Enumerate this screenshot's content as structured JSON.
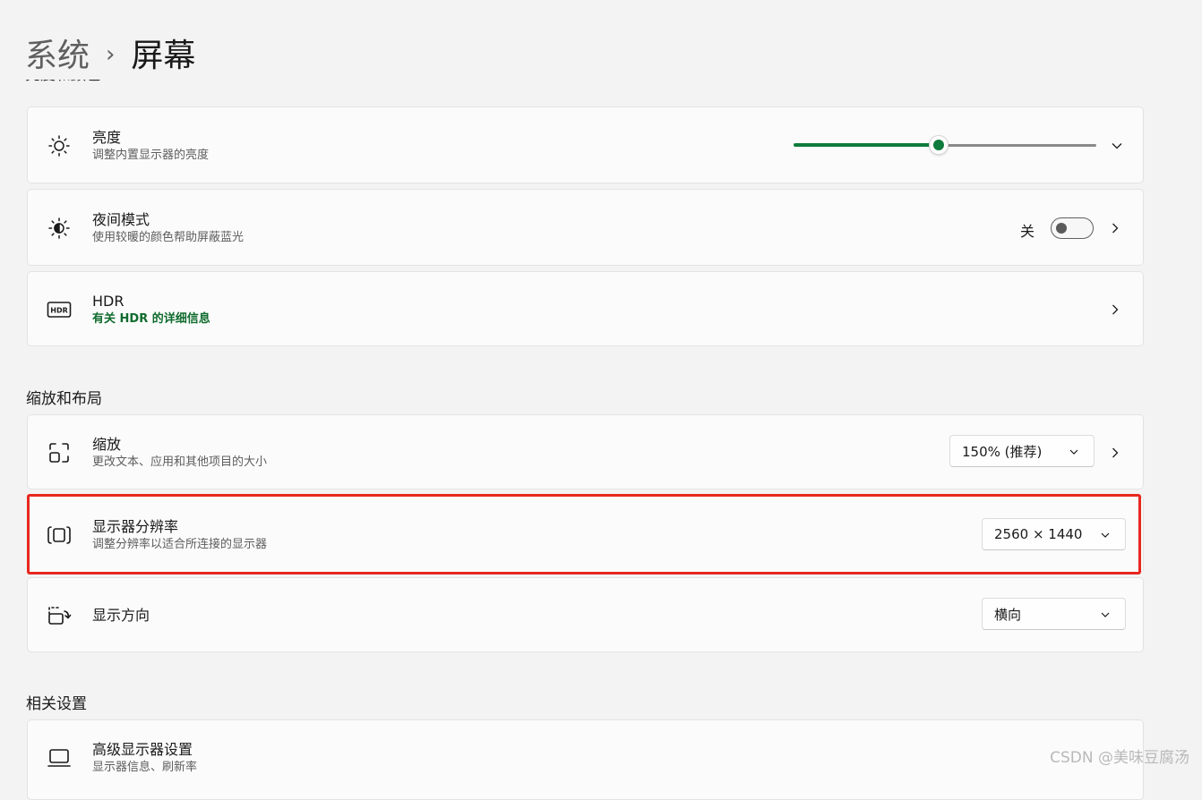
{
  "breadcrumb": {
    "parent": "系统",
    "separator": "›",
    "current": "屏幕"
  },
  "sections": {
    "brightness_color": "亮度和颜色",
    "scale_layout": "缩放和布局",
    "related": "相关设置"
  },
  "brightness": {
    "title": "亮度",
    "subtitle": "调整内置显示器的亮度",
    "level_percent": 48,
    "icon": "sun-icon"
  },
  "night_light": {
    "title": "夜间模式",
    "subtitle": "使用较暖的颜色帮助屏蔽蓝光",
    "state_label": "关",
    "on": false,
    "icon": "night-light-icon"
  },
  "hdr": {
    "title": "HDR",
    "subtitle": "有关 HDR 的详细信息",
    "icon": "hdr-icon"
  },
  "scale": {
    "title": "缩放",
    "subtitle": "更改文本、应用和其他项目的大小",
    "value": "150% (推荐)",
    "icon": "scale-icon"
  },
  "resolution": {
    "title": "显示器分辨率",
    "subtitle": "调整分辨率以适合所连接的显示器",
    "value": "2560 × 1440",
    "icon": "resolution-icon"
  },
  "orientation": {
    "title": "显示方向",
    "value": "横向",
    "icon": "orientation-icon"
  },
  "advanced": {
    "title": "高级显示器设置",
    "subtitle": "显示器信息、刷新率",
    "icon": "monitor-icon"
  },
  "watermark": "CSDN @美味豆腐汤",
  "colors": {
    "accent": "#0f7b3c",
    "highlight": "#e8271f"
  }
}
